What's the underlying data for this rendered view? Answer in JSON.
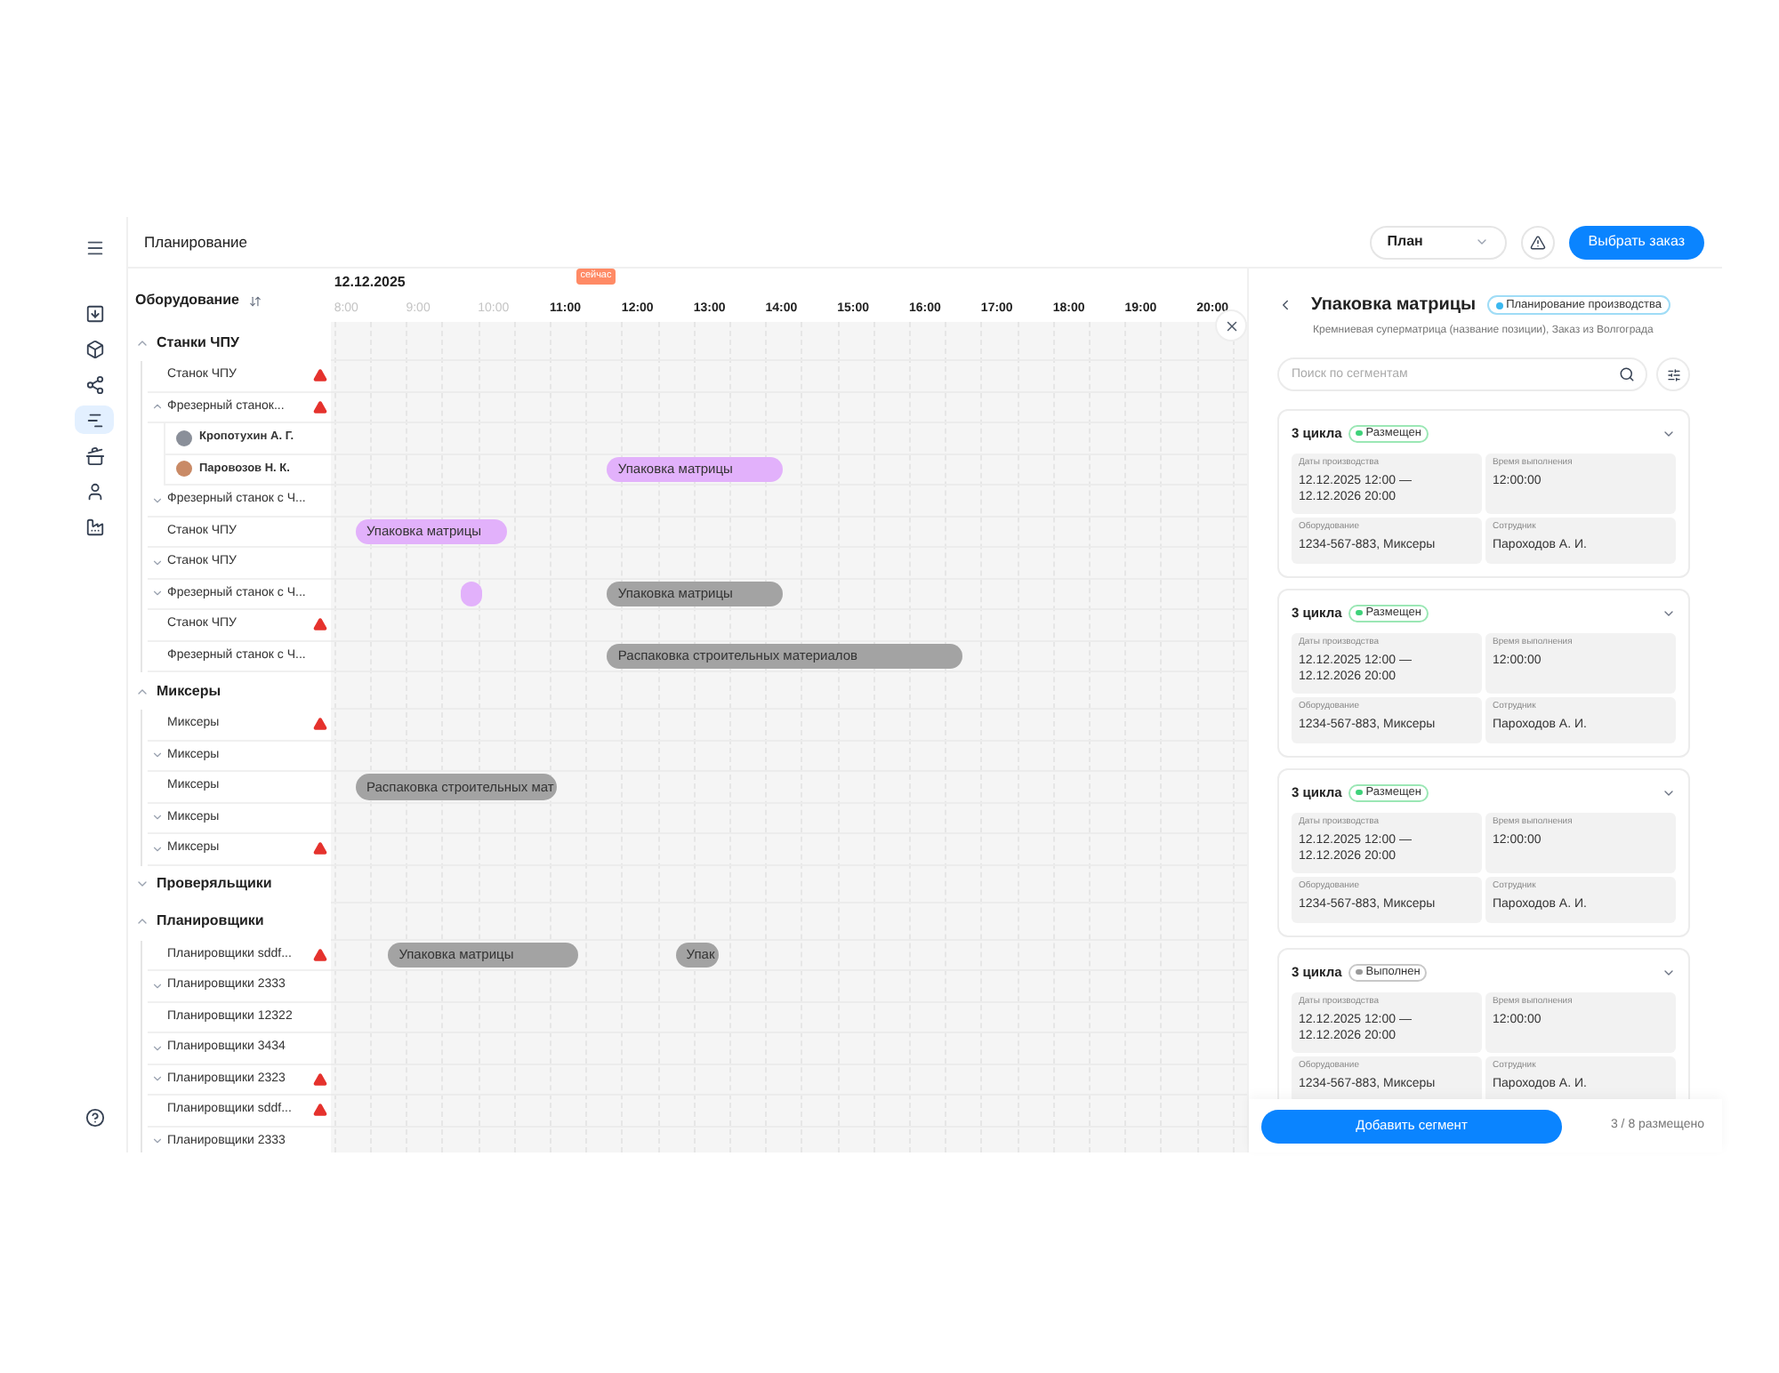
{
  "rail": {
    "items": [
      {
        "selected": false
      },
      {
        "selected": false
      },
      {
        "selected": false
      },
      {
        "selected": true
      },
      {
        "selected": false
      },
      {
        "selected": false
      },
      {
        "selected": false
      }
    ]
  },
  "header": {
    "title": "Планирование",
    "view_select": "План",
    "primary_button": "Выбрать заказ"
  },
  "equipment": {
    "title": "Оборудование",
    "groups": [
      {
        "label": "Станки ЧПУ",
        "expanded": true,
        "children": [
          {
            "kind": "leaf",
            "label": "Станок ЧПУ",
            "warning": true
          },
          {
            "kind": "node",
            "label": "Фрезерный станок...",
            "expanded": true,
            "warning": true,
            "children": [
              {
                "kind": "person",
                "label": "Кропотухин А. Г.",
                "color": "#8a8f99"
              },
              {
                "kind": "person",
                "label": "Паровозов Н. К.",
                "color": "#c98a66",
                "bars": [
                  {
                    "label": "Упаковка матрицы",
                    "color": "#e2b1fb"
                  }
                ]
              }
            ]
          },
          {
            "kind": "node",
            "label": "Фрезерный станок с Ч...",
            "expanded": false,
            "warning": false
          },
          {
            "kind": "leaf",
            "label": "Станок ЧПУ",
            "warning": false,
            "bars": [
              {
                "label": "Упаковка матрицы",
                "color": "#e2b1fb"
              }
            ]
          },
          {
            "kind": "node",
            "label": "Станок ЧПУ",
            "expanded": false,
            "warning": false
          },
          {
            "kind": "node",
            "label": "Фрезерный станок с Ч...",
            "expanded": false,
            "warning": false,
            "bars": [
              {
                "color": "#e2b1fb"
              },
              {
                "label": "Упаковка матрицы",
                "color": "#a3a3a3"
              }
            ]
          },
          {
            "kind": "leaf",
            "label": "Станок ЧПУ",
            "warning": true
          },
          {
            "kind": "leaf",
            "label": "Фрезерный станок с Ч...",
            "warning": false,
            "bars": [
              {
                "label": "Распаковка строительных материалов",
                "color": "#a3a3a3"
              }
            ]
          }
        ]
      },
      {
        "label": "Миксеры",
        "expanded": true,
        "children": [
          {
            "kind": "leaf",
            "label": "Миксеры",
            "warning": true
          },
          {
            "kind": "node",
            "label": "Миксеры",
            "expanded": false,
            "warning": false
          },
          {
            "kind": "leaf",
            "label": "Миксеры",
            "warning": false,
            "bars": [
              {
                "label": "Распаковка строительных мат",
                "color": "#a3a3a3"
              }
            ]
          },
          {
            "kind": "node",
            "label": "Миксеры",
            "expanded": false,
            "warning": false
          },
          {
            "kind": "node",
            "label": "Миксеры",
            "expanded": false,
            "warning": true
          }
        ]
      },
      {
        "label": "Проверяльщики",
        "expanded": false
      },
      {
        "label": "Планировщики",
        "expanded": true,
        "children": [
          {
            "kind": "leaf",
            "label": "Планировщики sddf...",
            "warning": true,
            "bars": [
              {
                "label": "Упаковка матрицы",
                "color": "#a3a3a3"
              },
              {
                "label": "Упак",
                "color": "#a3a3a3"
              }
            ]
          },
          {
            "kind": "node",
            "label": "Планировщики 2333",
            "expanded": false,
            "warning": false
          },
          {
            "kind": "leaf",
            "label": "Планировщики 12322",
            "warning": false
          },
          {
            "kind": "node",
            "label": "Планировщики 3434",
            "expanded": false,
            "warning": false
          },
          {
            "kind": "node",
            "label": "Планировщики 2323",
            "expanded": false,
            "warning": true
          },
          {
            "kind": "leaf",
            "label": "Планировщики sddf...",
            "warning": true
          },
          {
            "kind": "node",
            "label": "Планировщики 2333",
            "expanded": false,
            "warning": false
          }
        ]
      }
    ]
  },
  "timeline": {
    "date": "12.12.2025",
    "hours": [
      {
        "label": "8:00",
        "past": true
      },
      {
        "label": "9:00",
        "past": true
      },
      {
        "label": "10:00",
        "past": true
      },
      {
        "label": "11:00",
        "past": false
      },
      {
        "label": "12:00",
        "past": false
      },
      {
        "label": "13:00",
        "past": false
      },
      {
        "label": "14:00",
        "past": false
      },
      {
        "label": "15:00",
        "past": false
      },
      {
        "label": "16:00",
        "past": false
      },
      {
        "label": "17:00",
        "past": false
      },
      {
        "label": "18:00",
        "past": false
      },
      {
        "label": "19:00",
        "past": false
      },
      {
        "label": "20:00",
        "past": false
      }
    ],
    "now": {
      "label": "сейчас"
    }
  },
  "panel": {
    "title": "Упаковка матрицы",
    "tag": "Планирование производства",
    "subtitle": "Кремниевая суперматрица (название позиции), Заказ из Волгограда",
    "search": {
      "placeholder": "Поиск по сегментам"
    },
    "segments": [
      {
        "title": "3 цикла",
        "status": {
          "label": "Размещен",
          "kind": "placed"
        },
        "fields": [
          {
            "label": "Даты производства",
            "value": "12.12.2025 12:00 — 12.12.2026 20:00"
          },
          {
            "label": "Время выполнения",
            "value": "12:00:00"
          },
          {
            "label": "Оборудование",
            "value": "1234-567-883, Миксеры"
          },
          {
            "label": "Сотрудник",
            "value": "Пароходов А. И."
          }
        ]
      },
      {
        "title": "3 цикла",
        "status": {
          "label": "Размещен",
          "kind": "placed"
        },
        "fields": [
          {
            "label": "Даты производства",
            "value": "12.12.2025 12:00 — 12.12.2026 20:00"
          },
          {
            "label": "Время выполнения",
            "value": "12:00:00"
          },
          {
            "label": "Оборудование",
            "value": "1234-567-883, Миксеры"
          },
          {
            "label": "Сотрудник",
            "value": "Пароходов А. И."
          }
        ]
      },
      {
        "title": "3 цикла",
        "status": {
          "label": "Размещен",
          "kind": "placed"
        },
        "fields": [
          {
            "label": "Даты производства",
            "value": "12.12.2025 12:00 — 12.12.2026 20:00"
          },
          {
            "label": "Время выполнения",
            "value": "12:00:00"
          },
          {
            "label": "Оборудование",
            "value": "1234-567-883, Миксеры"
          },
          {
            "label": "Сотрудник",
            "value": "Пароходов А. И."
          }
        ]
      },
      {
        "title": "3 цикла",
        "status": {
          "label": "Выполнен",
          "kind": "done"
        },
        "fields": [
          {
            "label": "Даты производства",
            "value": "12.12.2025 12:00 — 12.12.2026 20:00"
          },
          {
            "label": "Время выполнения",
            "value": "12:00:00"
          },
          {
            "label": "Оборудование",
            "value": "1234-567-883, Миксеры"
          },
          {
            "label": "Сотрудник",
            "value": "Пароходов А. И."
          }
        ]
      }
    ],
    "add_button": "Добавить сегмент",
    "counter": "3 / 8 размещено"
  }
}
